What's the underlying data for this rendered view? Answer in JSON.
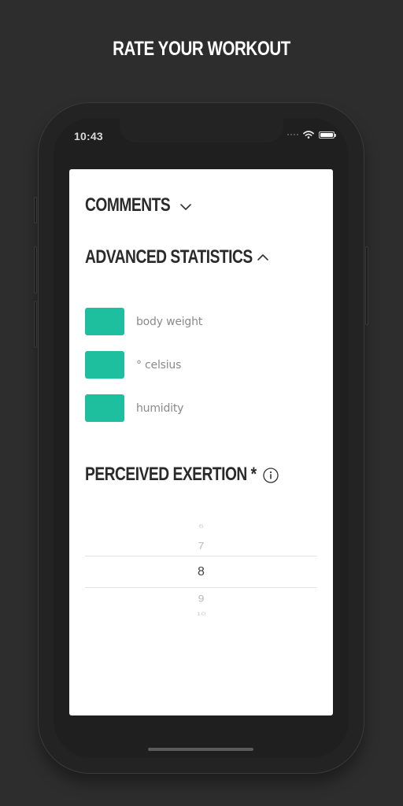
{
  "header": {
    "title": "RATE YOUR WORKOUT"
  },
  "status_bar": {
    "time": "10:43"
  },
  "sections": {
    "comments": {
      "title": "COMMENTS",
      "expanded": false
    },
    "advanced": {
      "title": "ADVANCED STATISTICS",
      "expanded": true
    },
    "exertion": {
      "title": "PERCEIVED EXERTION *"
    }
  },
  "stats": [
    {
      "label": "body weight",
      "value": ""
    },
    {
      "label": "° celsius",
      "value": ""
    },
    {
      "label": "humidity",
      "value": ""
    }
  ],
  "picker": {
    "values": [
      "6",
      "7",
      "8",
      "9",
      "10"
    ],
    "selected": "8"
  },
  "colors": {
    "accent": "#1dbf9f",
    "background": "#2d2d2d",
    "card": "#ffffff",
    "title_text": "#2a2a2a",
    "label_text": "#8a8a8a"
  },
  "icons": {
    "comments_toggle": "chevron-down-icon",
    "advanced_toggle": "chevron-up-icon",
    "exertion_info": "info-icon",
    "wifi": "wifi-icon",
    "battery": "battery-icon"
  }
}
